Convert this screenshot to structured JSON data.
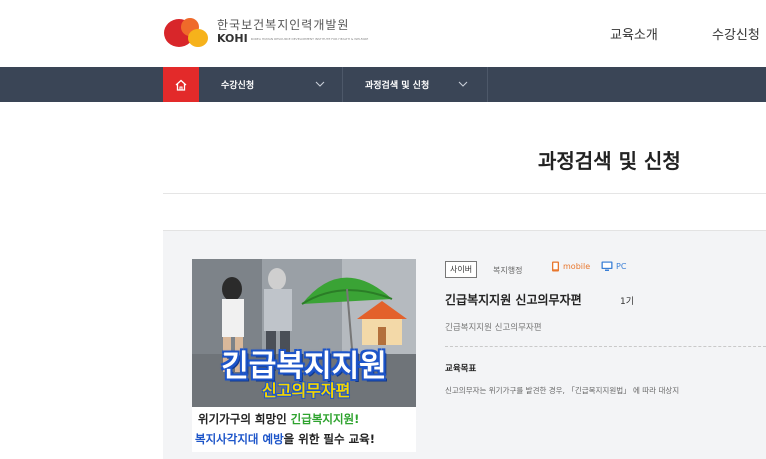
{
  "header": {
    "org_name_kr": "한국보건복지인력개발원",
    "org_abbr": "KOHI",
    "org_name_en": "KOREA HUMAN RESOURCE DEVELOPMENT INSTITUTE FOR HEALTH & WELFARE",
    "nav": [
      "교육소개",
      "수강신청"
    ]
  },
  "gnb": {
    "items": [
      {
        "label": "수강신청",
        "icon": "chevron-down-icon"
      },
      {
        "label": "과정검색 및 신청",
        "icon": "chevron-down-icon"
      }
    ],
    "home_icon": "home-icon"
  },
  "page": {
    "title": "과정검색 및 신청"
  },
  "course": {
    "type_badge": "사이버",
    "category": "복지행정",
    "mobile_label": "mobile",
    "pc_label": "PC",
    "title": "긴급복지지원 신고의무자편",
    "round": "1기",
    "subtitle": "긴급복지지원 신고의무자편",
    "objective_label": "교육목표",
    "objective_text": "신고의무자는 위기가구를 발견한 경우, 「긴급복지지원법」 에 따라 대상지",
    "thumbnail": {
      "headline": "긴급복지지원",
      "subheadline": "신고의무자편",
      "line1_prefix": "위기가구의 희망인 ",
      "line1_highlight": "긴급복지지원!",
      "line2_blue": "복지사각지대 예방",
      "line2_rest": "을 위한 필수 교육!"
    }
  },
  "colors": {
    "gnb_bg": "#3a4556",
    "home_bg": "#e32a2a",
    "card_bg": "#f3f4f6",
    "mobile": "#e8772e",
    "pc": "#3a7fd6"
  }
}
